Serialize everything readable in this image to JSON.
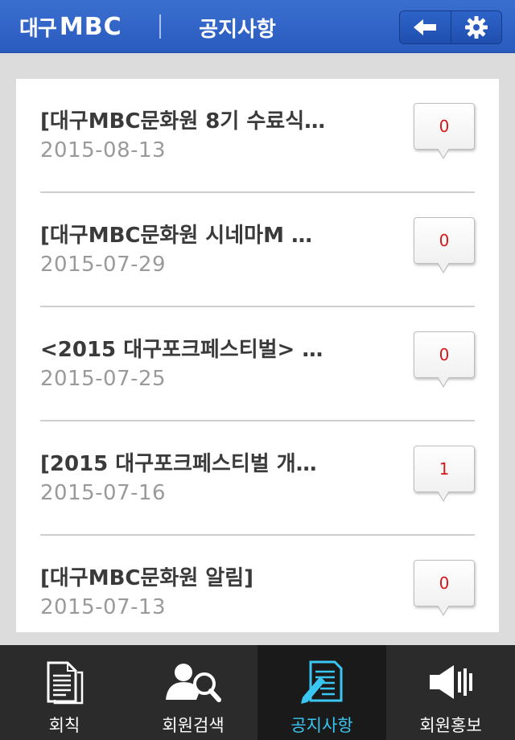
{
  "header": {
    "logo_kr": "대구",
    "logo_en": "MBC",
    "title": "공지사항",
    "back_icon": "back-arrow-icon",
    "settings_icon": "gear-icon"
  },
  "notices": [
    {
      "title": "[대구MBC문화원 8기 수료식…",
      "date": "2015-08-13",
      "count": "0"
    },
    {
      "title": "[대구MBC문화원 시네마M …",
      "date": "2015-07-29",
      "count": "0"
    },
    {
      "title": "<2015 대구포크페스티벌> …",
      "date": "2015-07-25",
      "count": "0"
    },
    {
      "title": "[2015 대구포크페스티벌 개…",
      "date": "2015-07-16",
      "count": "1"
    },
    {
      "title": "[대구MBC문화원 알림]",
      "date": "2015-07-13",
      "count": "0"
    }
  ],
  "tabs": [
    {
      "label": "회칙",
      "icon": "document-icon"
    },
    {
      "label": "회원검색",
      "icon": "member-search-icon"
    },
    {
      "label": "공지사항",
      "icon": "notice-write-icon",
      "active": true
    },
    {
      "label": "회원홍보",
      "icon": "speaker-icon"
    }
  ],
  "colors": {
    "header": "#2f62c6",
    "count": "#d21a1a",
    "active_tab_label": "#3ac6f2",
    "tabbar": "#2b2b2b"
  }
}
